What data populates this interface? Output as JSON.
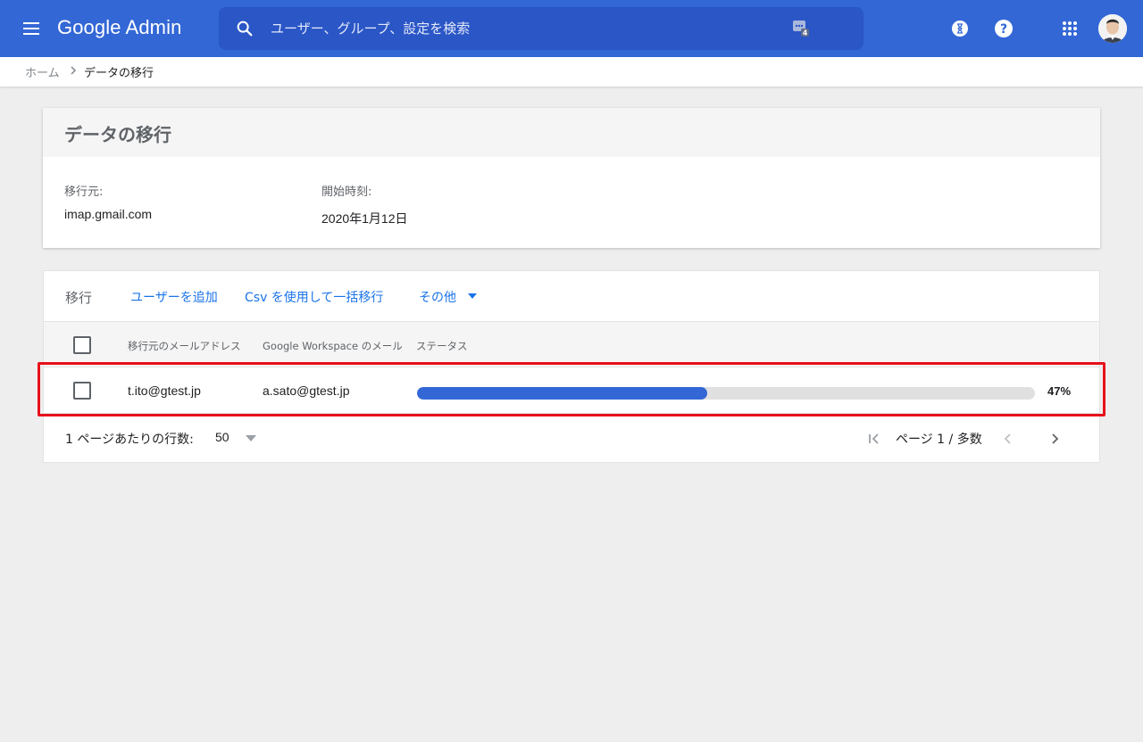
{
  "header": {
    "logo_text": "Google Admin",
    "search_placeholder": "ユーザー、グループ、設定を検索",
    "search_badge_count": "4",
    "icons": [
      "menu-icon",
      "search-icon",
      "support-badge-icon",
      "hourglass-icon",
      "help-icon",
      "apps-grid-icon",
      "avatar"
    ]
  },
  "breadcrumb": {
    "home": "ホーム",
    "current": "データの移行"
  },
  "summary": {
    "title": "データの移行",
    "source_label": "移行元:",
    "source_value": "imap.gmail.com",
    "start_label": "開始時刻:",
    "start_value": "2020年1月12日"
  },
  "toolbar": {
    "title": "移行",
    "add_user": "ユーザーを追加",
    "bulk_csv": "Csv を使用して一括移行",
    "more": "その他"
  },
  "table": {
    "columns": [
      "移行元のメールアドレス",
      "Google Workspace のメール",
      "ステータス"
    ],
    "rows": [
      {
        "source_email": "t.ito@gtest.jp",
        "workspace_email": "a.sato@gtest.jp",
        "progress": 0.47,
        "status_label": "47%"
      }
    ]
  },
  "pagination": {
    "rows_per_page_label": "1 ページあたりの行数:",
    "rows_per_page_value": "50",
    "page_text": "ページ 1 / 多数"
  },
  "colors": {
    "brand_blue": "#3367d6",
    "link_blue": "#1a73e8",
    "highlight_red": "#e8101a"
  }
}
